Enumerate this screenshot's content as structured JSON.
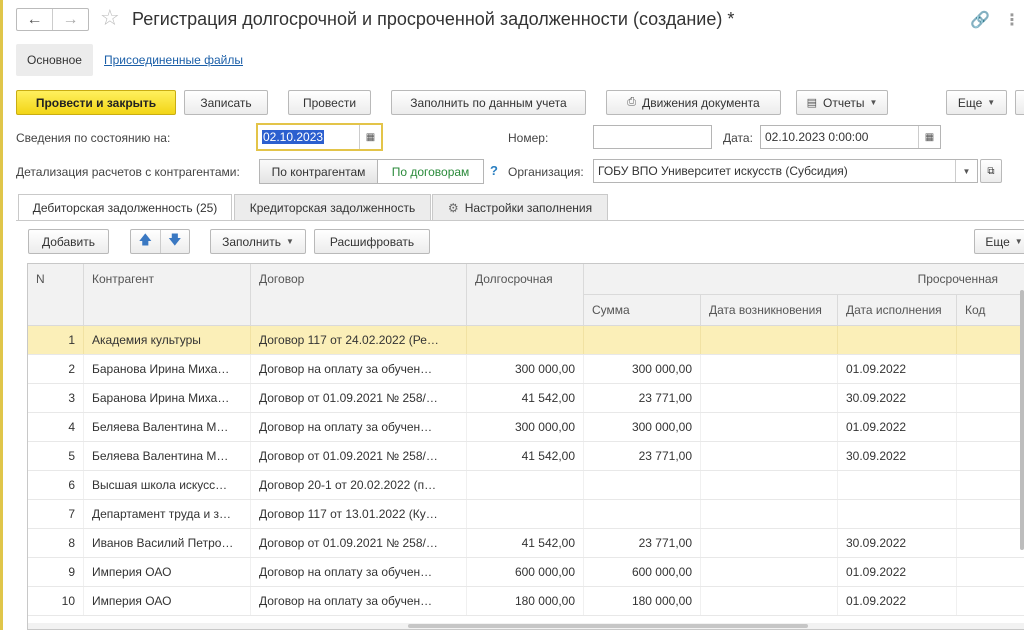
{
  "window": {
    "title": "Регистрация долгосрочной и просроченной задолженности (создание) *"
  },
  "subtabs": {
    "main": "Основное",
    "files": "Присоединенные файлы"
  },
  "toolbar": {
    "post_close": "Провести и закрыть",
    "save": "Записать",
    "post": "Провести",
    "fill_accounting": "Заполнить по данным учета",
    "movements": "Движения документа",
    "reports": "Отчеты",
    "more": "Еще"
  },
  "form": {
    "state_label": "Сведения по состоянию на:",
    "state_date": "02.10.2023",
    "number_label": "Номер:",
    "number_value": "",
    "date_label": "Дата:",
    "date_value": "02.10.2023  0:00:00",
    "detail_label": "Детализация расчетов с контрагентами:",
    "detail_by_counterparty": "По контрагентам",
    "detail_by_contract": "По договорам",
    "help": "?",
    "org_label": "Организация:",
    "org_value": "ГОБУ ВПО Университет искусств (Субсидия)"
  },
  "tabs": [
    {
      "label": "Дебиторская задолженность (25)"
    },
    {
      "label": "Кредиторская задолженность"
    },
    {
      "label": "Настройки заполнения"
    }
  ],
  "grid_toolbar": {
    "add": "Добавить",
    "fill": "Заполнить",
    "decode": "Расшифровать",
    "more": "Еще"
  },
  "table": {
    "headers": {
      "n": "N",
      "counterparty": "Контрагент",
      "contract": "Договор",
      "longterm": "Долгосрочная",
      "overdue": "Просроченная",
      "sum": "Сумма",
      "occur_date": "Дата возникновения",
      "due_date": "Дата исполнения",
      "code": "Код"
    },
    "rows": [
      {
        "n": "1",
        "counterparty": "Академия культуры",
        "contract": "Договор 117 от 24.02.2022 (Ре…",
        "longterm": "",
        "sum": "",
        "occur": "",
        "due": ""
      },
      {
        "n": "2",
        "counterparty": "Баранова Ирина Миха…",
        "contract": "Договор на оплату за обучен…",
        "longterm": "300 000,00",
        "sum": "300 000,00",
        "occur": "",
        "due": "01.09.2022"
      },
      {
        "n": "3",
        "counterparty": "Баранова Ирина Миха…",
        "contract": "Договор от 01.09.2021 № 258/…",
        "longterm": "41 542,00",
        "sum": "23 771,00",
        "occur": "",
        "due": "30.09.2022"
      },
      {
        "n": "4",
        "counterparty": "Беляева Валентина М…",
        "contract": "Договор на оплату за обучен…",
        "longterm": "300 000,00",
        "sum": "300 000,00",
        "occur": "",
        "due": "01.09.2022"
      },
      {
        "n": "5",
        "counterparty": "Беляева Валентина М…",
        "contract": "Договор от 01.09.2021 № 258/…",
        "longterm": "41 542,00",
        "sum": "23 771,00",
        "occur": "",
        "due": "30.09.2022"
      },
      {
        "n": "6",
        "counterparty": "Высшая школа искусс…",
        "contract": "Договор 20-1 от 20.02.2022 (п…",
        "longterm": "",
        "sum": "",
        "occur": "",
        "due": ""
      },
      {
        "n": "7",
        "counterparty": "Департамент труда и з…",
        "contract": "Договор 117 от 13.01.2022 (Ку…",
        "longterm": "",
        "sum": "",
        "occur": "",
        "due": ""
      },
      {
        "n": "8",
        "counterparty": "Иванов Василий Петро…",
        "contract": "Договор от 01.09.2021 № 258/…",
        "longterm": "41 542,00",
        "sum": "23 771,00",
        "occur": "",
        "due": "30.09.2022"
      },
      {
        "n": "9",
        "counterparty": "Империя ОАО",
        "contract": "Договор на оплату за обучен…",
        "longterm": "600 000,00",
        "sum": "600 000,00",
        "occur": "",
        "due": "01.09.2022"
      },
      {
        "n": "10",
        "counterparty": "Империя ОАО",
        "contract": "Договор на оплату за обучен…",
        "longterm": "180 000,00",
        "sum": "180 000,00",
        "occur": "",
        "due": "01.09.2022"
      }
    ]
  }
}
